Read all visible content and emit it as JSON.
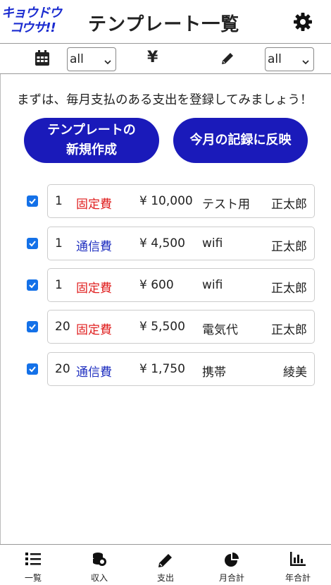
{
  "header": {
    "logo_line1": "キョウドウ",
    "logo_line2": "コウサ!!",
    "title": "テンプレート一覧",
    "settings_icon": "gear-icon"
  },
  "filters": {
    "calendar_icon": "calendar-icon",
    "day_select": "all",
    "yen_icon": "¥",
    "memo_icon": "pencil-icon",
    "user_select": "all"
  },
  "intro_text": "まずは、毎月支払のある支出を登録してみましょう！",
  "buttons": {
    "new_template_line1": "テンプレートの",
    "new_template_line2": "新規作成",
    "apply_label": "今月の記録に反映"
  },
  "templates": [
    {
      "checked": true,
      "day": "1",
      "category": "固定費",
      "category_color": "#e02020",
      "amount": "¥ 10,000",
      "memo": "テスト用",
      "user": "正太郎"
    },
    {
      "checked": true,
      "day": "1",
      "category": "通信費",
      "category_color": "#2030c0",
      "amount": "¥ 4,500",
      "memo": "wifi",
      "user": "正太郎"
    },
    {
      "checked": true,
      "day": "1",
      "category": "固定費",
      "category_color": "#e02020",
      "amount": "¥ 600",
      "memo": "wifi",
      "user": "正太郎"
    },
    {
      "checked": true,
      "day": "20",
      "category": "固定費",
      "category_color": "#e02020",
      "amount": "¥ 5,500",
      "memo": "電気代",
      "user": "正太郎"
    },
    {
      "checked": true,
      "day": "20",
      "category": "通信費",
      "category_color": "#2030c0",
      "amount": "¥ 1,750",
      "memo": "携帯",
      "user": "綾美"
    }
  ],
  "nav": [
    {
      "label": "一覧",
      "icon": "list-icon"
    },
    {
      "label": "収入",
      "icon": "coins-icon"
    },
    {
      "label": "支出",
      "icon": "pencil-icon"
    },
    {
      "label": "月合計",
      "icon": "pie-chart-icon"
    },
    {
      "label": "年合計",
      "icon": "bar-chart-icon"
    }
  ],
  "colors": {
    "accent": "#1a1aba",
    "checkbox": "#1471e8",
    "fixed_cost": "#e02020",
    "telecom": "#2030c0"
  }
}
